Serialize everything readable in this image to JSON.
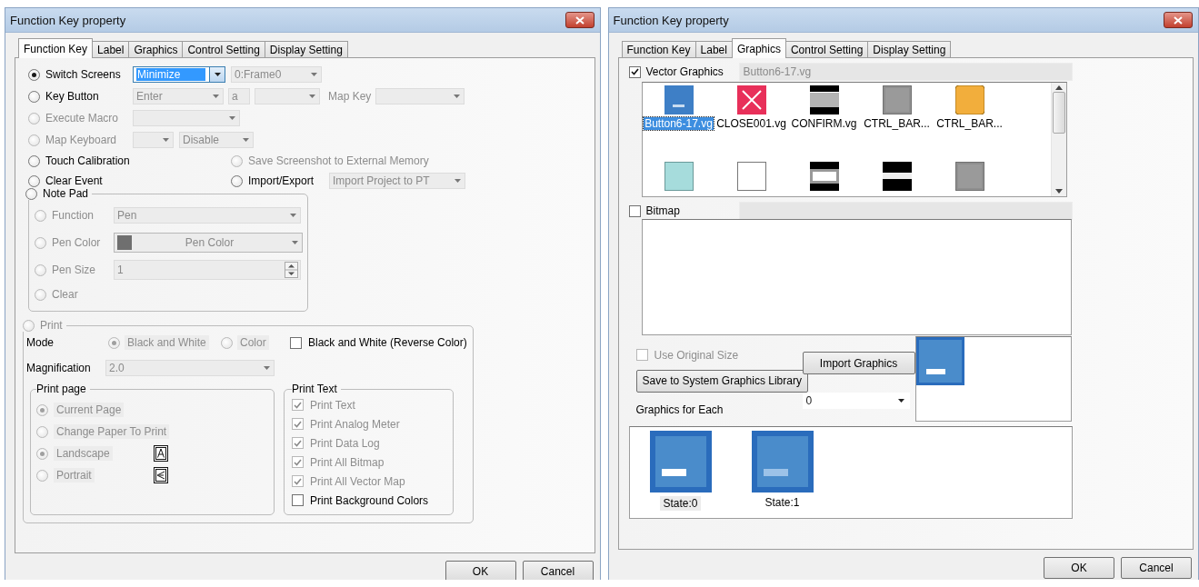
{
  "dialogs": [
    {
      "kind": "function_key",
      "title": "Function Key property",
      "tabs": [
        {
          "label": "Function Key",
          "selected": true
        },
        {
          "label": "Label",
          "selected": false
        },
        {
          "label": "Graphics",
          "selected": false
        },
        {
          "label": "Control Setting",
          "selected": false
        },
        {
          "label": "Display Setting",
          "selected": false
        }
      ],
      "radios": [
        {
          "kind": "switch",
          "label": "Switch Screens",
          "selected": true,
          "disabled": false,
          "combo": "Minimize",
          "combo2": "0:Frame0"
        },
        {
          "kind": "key",
          "label": "Key Button",
          "selected": false,
          "disabled": false,
          "combo": "Enter",
          "char": "a",
          "map_label": "Map Key"
        },
        {
          "kind": "macro",
          "label": "Execute Macro",
          "selected": false,
          "disabled": true
        },
        {
          "kind": "map",
          "label": "Map Keyboard",
          "selected": false,
          "disabled": true,
          "combo2": "Disable"
        },
        {
          "kind": "pair",
          "label": "Touch Calibration",
          "selected": false,
          "disabled": false,
          "right": {
            "label": "Save Screenshot to External Memory",
            "selected": false,
            "disabled": true
          }
        },
        {
          "kind": "pair",
          "label": "Clear Event",
          "selected": false,
          "disabled": false,
          "right": {
            "label": "Import/Export",
            "selected": false,
            "disabled": false,
            "combo": "Import Project to PT"
          }
        }
      ],
      "note_pad": {
        "label": "Note Pad",
        "selected": false,
        "items": [
          {
            "kind": "combo",
            "label": "Function",
            "selected": false,
            "value": "Pen"
          },
          {
            "kind": "color",
            "label": "Pen Color",
            "selected": false,
            "value": "Pen Color"
          },
          {
            "kind": "spin",
            "label": "Pen Size",
            "selected": false,
            "value": "1"
          },
          {
            "kind": "plain",
            "label": "Clear",
            "selected": false
          }
        ]
      },
      "print": {
        "label": "Print",
        "selected": false,
        "mode_label": "Mode",
        "modes": [
          {
            "label": "Black and White",
            "selected": true
          },
          {
            "label": "Color",
            "selected": false
          }
        ],
        "reverse": {
          "label": "Black and White (Reverse Color)",
          "checked": false
        },
        "magnification_label": "Magnification",
        "magnification": "2.0",
        "print_page": {
          "title": "Print page",
          "items": [
            {
              "kind": "plain",
              "label": "Current Page",
              "selected": true
            },
            {
              "kind": "plain",
              "label": "Change Paper To Print",
              "selected": false
            },
            {
              "kind": "landscape",
              "label": "Landscape",
              "selected": true
            },
            {
              "kind": "portrait",
              "label": "Portrait",
              "selected": false
            }
          ]
        },
        "print_text": {
          "title": "Print Text",
          "items": [
            {
              "label": "Print Text",
              "checked": true
            },
            {
              "label": "Print Analog Meter",
              "checked": true
            },
            {
              "label": "Print Data Log",
              "checked": true
            },
            {
              "label": "Print All Bitmap",
              "checked": true
            },
            {
              "label": "Print All Vector Map",
              "checked": true
            },
            {
              "label": "Print Background Colors",
              "checked": false
            }
          ]
        }
      },
      "buttons": [
        "OK",
        "Cancel"
      ]
    },
    {
      "kind": "graphics",
      "title": "Function Key property",
      "tabs": [
        {
          "label": "Function Key",
          "selected": false
        },
        {
          "label": "Label",
          "selected": false
        },
        {
          "label": "Graphics",
          "selected": true
        },
        {
          "label": "Control Setting",
          "selected": false
        },
        {
          "label": "Display Setting",
          "selected": false
        }
      ],
      "vector": {
        "label": "Vector Graphics",
        "checked": true,
        "file": "Button6-17.vg",
        "items": [
          {
            "kind": "blue",
            "label": "Button6-17.vg",
            "selected": true
          },
          {
            "kind": "close",
            "label": "CLOSE001.vg",
            "selected": false
          },
          {
            "kind": "bars",
            "label": "CONFIRM.vg",
            "selected": false
          },
          {
            "kind": "gray",
            "label": "CTRL_BAR...",
            "selected": false
          },
          {
            "kind": "orange",
            "label": "CTRL_BAR...",
            "selected": false
          },
          {
            "kind": "teal",
            "selected": false
          },
          {
            "kind": "white",
            "selected": false
          },
          {
            "kind": "band",
            "selected": false
          },
          {
            "kind": "stripe",
            "selected": false
          },
          {
            "kind": "gray",
            "selected": false
          }
        ]
      },
      "bitmap": {
        "label": "Bitmap",
        "checked": false
      },
      "use_original": {
        "label": "Use Original Size",
        "checked": false
      },
      "import_button": "Import Graphics",
      "save_button": "Save to System Graphics Library",
      "each_label": "Graphics for Each",
      "each_value": "0",
      "states": [
        {
          "kind": "solid",
          "label": "State:0",
          "selected": true
        },
        {
          "kind": "faded",
          "label": "State:1",
          "selected": false
        }
      ],
      "buttons": [
        "OK",
        "Cancel"
      ]
    }
  ]
}
